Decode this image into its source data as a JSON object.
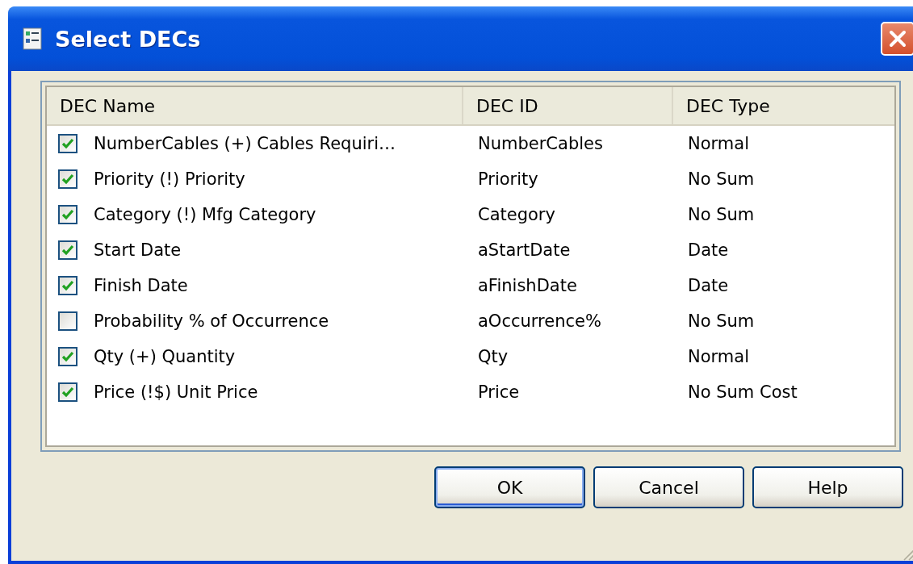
{
  "window": {
    "title": "Select DECs"
  },
  "table": {
    "columns": [
      "DEC Name",
      "DEC ID",
      "DEC Type"
    ],
    "rows": [
      {
        "checked": true,
        "name": "NumberCables (+) Cables Requiri…",
        "id": "NumberCables",
        "type": "Normal"
      },
      {
        "checked": true,
        "name": "Priority (!) Priority",
        "id": "Priority",
        "type": "No Sum"
      },
      {
        "checked": true,
        "name": "Category (!) Mfg Category",
        "id": "Category",
        "type": "No Sum"
      },
      {
        "checked": true,
        "name": "Start Date",
        "id": "aStartDate",
        "type": "Date"
      },
      {
        "checked": true,
        "name": "Finish Date",
        "id": "aFinishDate",
        "type": "Date"
      },
      {
        "checked": false,
        "name": "Probability % of Occurrence",
        "id": "aOccurrence%",
        "type": "No Sum"
      },
      {
        "checked": true,
        "name": "Qty (+) Quantity",
        "id": "Qty",
        "type": "Normal"
      },
      {
        "checked": true,
        "name": "Price (!$) Unit Price",
        "id": "Price",
        "type": "No Sum Cost"
      }
    ]
  },
  "buttons": [
    {
      "label": "OK",
      "default": true
    },
    {
      "label": "Cancel",
      "default": false
    },
    {
      "label": "Help",
      "default": false
    }
  ]
}
